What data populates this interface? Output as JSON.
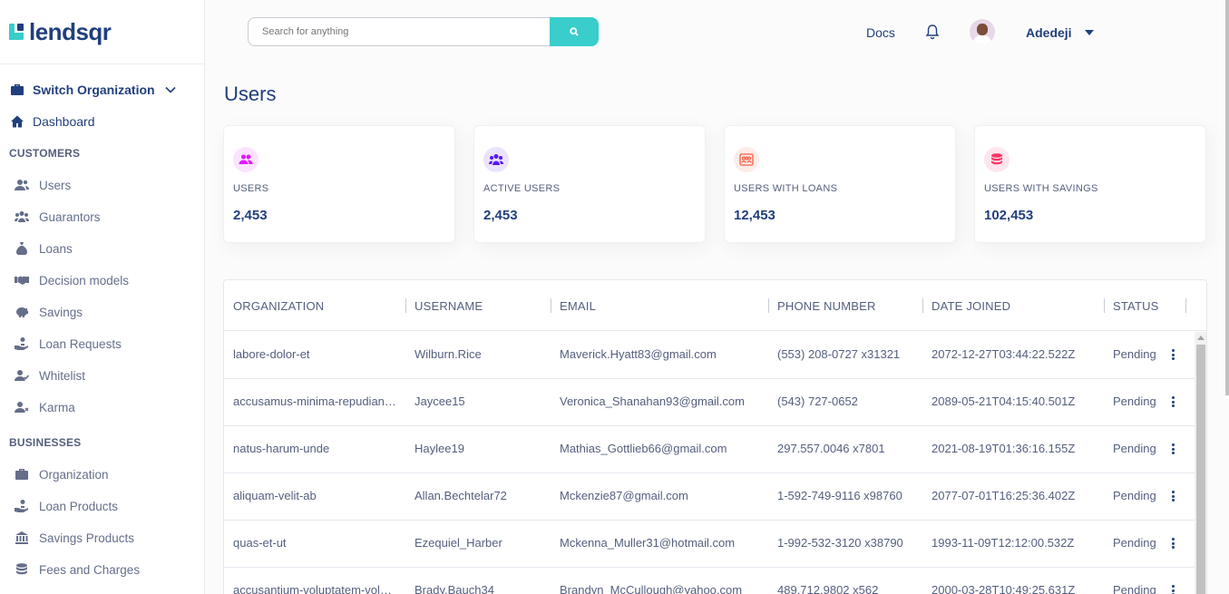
{
  "brand": {
    "name": "lendsqr",
    "accent": "#39cdcc",
    "primary": "#213f7d"
  },
  "sidebar": {
    "switch_org": "Switch Organization",
    "dashboard": "Dashboard",
    "sections": [
      {
        "title": "CUSTOMERS",
        "items": [
          {
            "label": "Users",
            "icon": "users-icon"
          },
          {
            "label": "Guarantors",
            "icon": "guarantors-icon"
          },
          {
            "label": "Loans",
            "icon": "loan-sack-icon"
          },
          {
            "label": "Decision models",
            "icon": "handshake-icon"
          },
          {
            "label": "Savings",
            "icon": "piggy-bank-icon"
          },
          {
            "label": "Loan Requests",
            "icon": "loan-request-icon"
          },
          {
            "label": "Whitelist",
            "icon": "user-check-icon"
          },
          {
            "label": "Karma",
            "icon": "user-x-icon"
          }
        ]
      },
      {
        "title": "BUSINESSES",
        "items": [
          {
            "label": "Organization",
            "icon": "briefcase-icon"
          },
          {
            "label": "Loan Products",
            "icon": "loan-request-icon"
          },
          {
            "label": "Savings Products",
            "icon": "bank-icon"
          },
          {
            "label": "Fees and Charges",
            "icon": "coins-icon"
          }
        ]
      }
    ]
  },
  "header": {
    "search_placeholder": "Search for anything",
    "docs": "Docs",
    "user_name": "Adedeji"
  },
  "page_title": "Users",
  "stats": [
    {
      "label": "USERS",
      "value": "2,453",
      "icon": "users-icon",
      "color": "#df18ff"
    },
    {
      "label": "ACTIVE USERS",
      "value": "2,453",
      "icon": "active-users-icon",
      "color": "#5718ff"
    },
    {
      "label": "USERS WITH LOANS",
      "value": "12,453",
      "icon": "loans-users-icon",
      "color": "#f55f44"
    },
    {
      "label": "USERS WITH SAVINGS",
      "value": "102,453",
      "icon": "savings-coins-icon",
      "color": "#ff3366"
    }
  ],
  "table": {
    "columns": [
      "ORGANIZATION",
      "USERNAME",
      "EMAIL",
      "PHONE NUMBER",
      "DATE JOINED",
      "STATUS"
    ],
    "rows": [
      [
        "labore-dolor-et",
        "Wilburn.Rice",
        "Maverick.Hyatt83@gmail.com",
        "(553) 208-0727 x31321",
        "2072-12-27T03:44:22.522Z",
        "Pending"
      ],
      [
        "accusamus-minima-repudiandae",
        "Jaycee15",
        "Veronica_Shanahan93@gmail.com",
        "(543) 727-0652",
        "2089-05-21T04:15:40.501Z",
        "Pending"
      ],
      [
        "natus-harum-unde",
        "Haylee19",
        "Mathias_Gottlieb66@gmail.com",
        "297.557.0046 x7801",
        "2021-08-19T01:36:16.155Z",
        "Pending"
      ],
      [
        "aliquam-velit-ab",
        "Allan.Bechtelar72",
        "Mckenzie87@gmail.com",
        "1-592-749-9116 x98760",
        "2077-07-01T16:25:36.402Z",
        "Pending"
      ],
      [
        "quas-et-ut",
        "Ezequiel_Harber",
        "Mckenna_Muller31@hotmail.com",
        "1-992-532-3120 x38790",
        "1993-11-09T12:12:00.532Z",
        "Pending"
      ],
      [
        "accusantium-voluptatem-voluptas",
        "Brady.Bauch34",
        "Brandyn_McCullough@yahoo.com",
        "489.712.9802 x562",
        "2000-03-28T10:49:25.631Z",
        "Pending"
      ]
    ]
  }
}
